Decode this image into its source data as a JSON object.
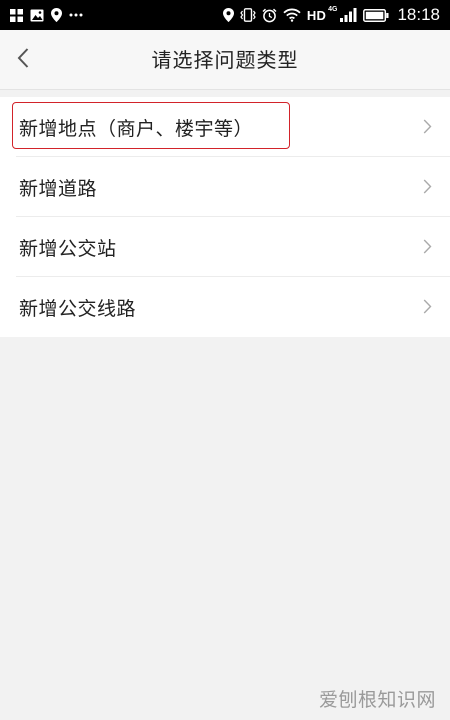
{
  "status_bar": {
    "network_label": "HD",
    "network_type": "4G",
    "time": "18:18",
    "left_icons": [
      "app-grid-icon",
      "image-icon",
      "location-pin-icon",
      "more-dots-icon"
    ],
    "right_icons": [
      "location-pin-icon",
      "vibrate-icon",
      "alarm-icon",
      "wifi-icon",
      "signal-icon",
      "battery-icon"
    ]
  },
  "header": {
    "title": "请选择问题类型",
    "back_icon": "chevron-left-icon"
  },
  "list": {
    "items": [
      {
        "label": "新增地点（商户、楼宇等）",
        "highlighted": true
      },
      {
        "label": "新增道路",
        "highlighted": false
      },
      {
        "label": "新增公交站",
        "highlighted": false
      },
      {
        "label": "新增公交线路",
        "highlighted": false
      }
    ],
    "highlight_color": "#d2232a"
  },
  "watermark": {
    "text": "爱刨根知识网"
  }
}
